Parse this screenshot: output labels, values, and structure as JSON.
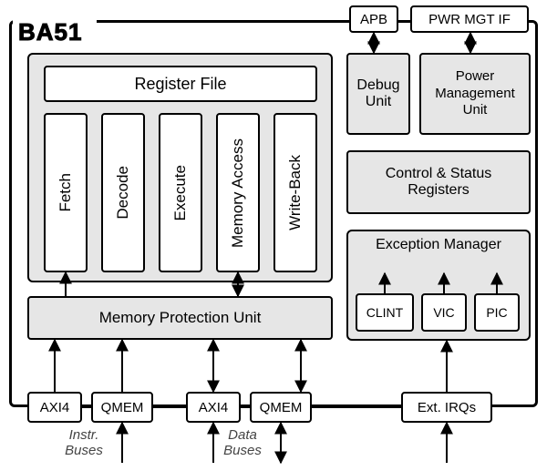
{
  "title": "BA51",
  "top_right": {
    "apb": "APB",
    "pwr_mgt_if": "PWR MGT IF"
  },
  "pipeline": {
    "register_file": "Register File",
    "stages": [
      "Fetch",
      "Decode",
      "Execute",
      "Memory Access",
      "Write-Back"
    ]
  },
  "mpu": "Memory Protection Unit",
  "debug": "Debug\nUnit",
  "pmu": "Power\nManagement\nUnit",
  "csr": "Control & Status\nRegisters",
  "exmgr": "Exception Manager",
  "intr": {
    "clint": "CLINT",
    "vic": "VIC",
    "pic": "PIC"
  },
  "bus": {
    "axi4_i": "AXI4",
    "qmem_i": "QMEM",
    "axi4_d": "AXI4",
    "qmem_d": "QMEM",
    "ext_irqs": "Ext. IRQs"
  },
  "captions": {
    "instr": "Instr.\nBuses",
    "data": "Data\nBuses"
  }
}
